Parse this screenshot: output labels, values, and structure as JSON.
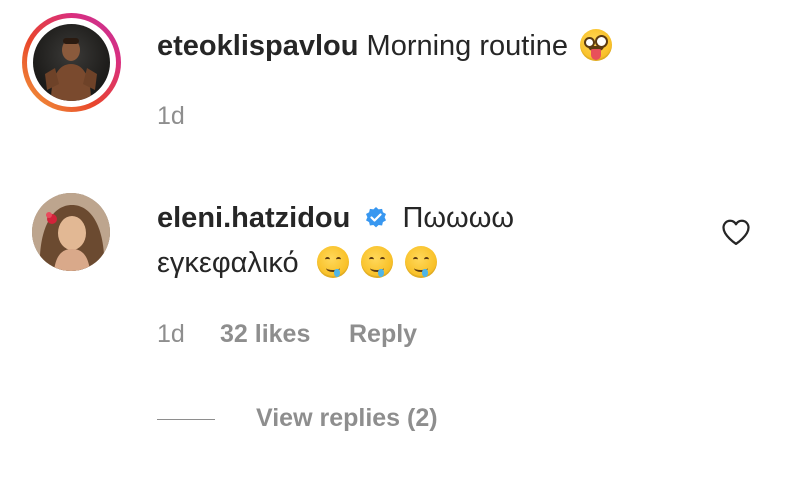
{
  "comments": [
    {
      "username": "eteoklispavlou",
      "text": "Morning routine",
      "emoji": "zany-face-emoji",
      "time": "1d",
      "avatar_ring": true
    },
    {
      "username": "eleni.hatzidou",
      "verified": true,
      "text_line1": "Πωωωω",
      "text_line2": "εγκεφαλικό",
      "emojis": [
        "drooling-face-emoji",
        "drooling-face-emoji",
        "drooling-face-emoji"
      ],
      "time": "1d",
      "likes": "32 likes",
      "reply_label": "Reply",
      "view_replies_label": "View replies (2)"
    }
  ],
  "icons": {
    "verified": "verified-badge-icon",
    "like": "heart-icon"
  },
  "colors": {
    "text": "#262626",
    "secondary": "#8e8e8e",
    "verified_blue": "#3897f0",
    "ring_gradient": [
      "#f2a33a",
      "#e8452c",
      "#d92e7f",
      "#c1359a"
    ]
  }
}
